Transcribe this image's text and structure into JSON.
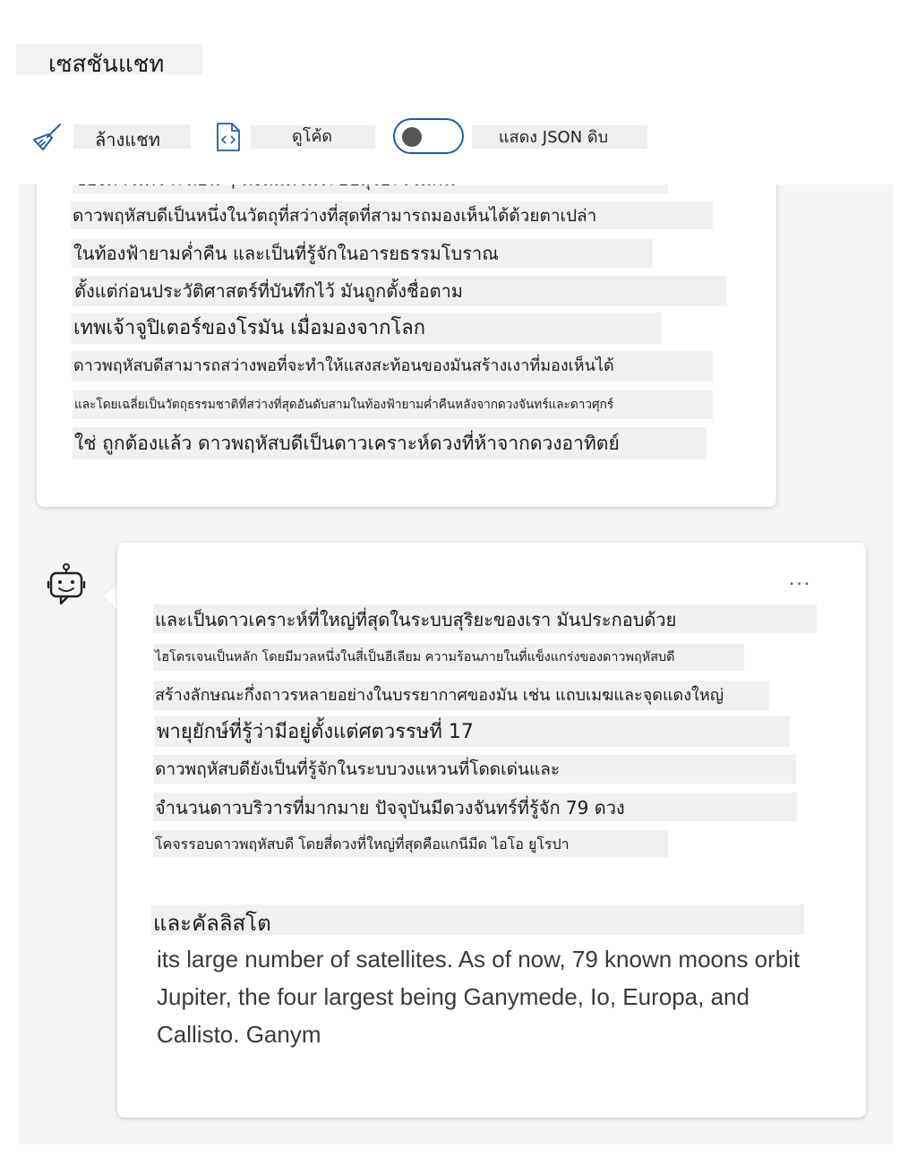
{
  "page": {
    "title": "เซสชันแชท"
  },
  "toolbar": {
    "clear_label": "ล้างแชท",
    "clear_icon": "broom-icon",
    "code_label": "ดูโค้ด",
    "code_icon": "code-file-icon",
    "json_toggle_label": "แสดง JSON ดิบ",
    "json_toggle_state": "off",
    "accent": "#1f5ea6"
  },
  "messages": [
    {
      "role": "user",
      "lines": [
        "ของดาวเคราะห์อื่น ๆ ทั้งหมดในระบบสุริยะรวมกัน",
        "ดาวพฤหัสบดีเป็นหนึ่งในวัตถุที่สว่างที่สุดที่สามารถมองเห็นได้ด้วยตาเปล่า",
        "ในท้องฟ้ายามค่ำคืน และเป็นที่รู้จักในอารยธรรมโบราณ",
        "ตั้งแต่ก่อนประวัติศาสตร์ที่บันทึกไว้ มันถูกตั้งชื่อตาม",
        "เทพเจ้าจูปิเตอร์ของโรมัน เมื่อมองจากโลก",
        "ดาวพฤหัสบดีสามารถสว่างพอที่จะทำให้แสงสะท้อนของมันสร้างเงาที่มองเห็นได้",
        "และโดยเฉลี่ยเป็นวัตถุธรรมชาติที่สว่างที่สุดอันดับสามในท้องฟ้ายามค่ำคืนหลังจากดวงจันทร์และดาวศุกร์",
        "ใช่ ถูกต้องแล้ว ดาวพฤหัสบดีเป็นดาวเคราะห์ดวงที่ห้าจากดวงอาทิตย์"
      ]
    },
    {
      "role": "assistant",
      "avatar_icon": "bot-icon",
      "more_label": "...",
      "lines": [
        "และเป็นดาวเคราะห์ที่ใหญ่ที่สุดในระบบสุริยะของเรา มันประกอบด้วย",
        "ไฮโดรเจนเป็นหลัก โดยมีมวลหนึ่งในสี่เป็นฮีเลียม ความร้อนภายในที่แข็งแกร่งของดาวพฤหัสบดี",
        "สร้างลักษณะกึ่งถาวรหลายอย่างในบรรยากาศของมัน เช่น แถบเมฆและจุดแดงใหญ่",
        "พายุยักษ์ที่รู้ว่ามีอยู่ตั้งแต่ศตวรรษที่ 17",
        "ดาวพฤหัสบดียังเป็นที่รู้จักในระบบวงแหวนที่โดดเด่นและ",
        "จำนวนดาวบริวารที่มากมาย ปัจจุบันมีดวงจันทร์ที่รู้จัก 79 ดวง",
        "โคจรรอบดาวพฤหัสบดี โดยสี่ดวงที่ใหญ่ที่สุดคือแกนีมีด ไอโอ ยูโรปา",
        "และคัลลิสโต"
      ],
      "english_text": "its large number of satellites. As of now, 79 known moons orbit Jupiter, the four largest being Ganymede, Io, Europa, and Callisto. Ganym"
    }
  ]
}
